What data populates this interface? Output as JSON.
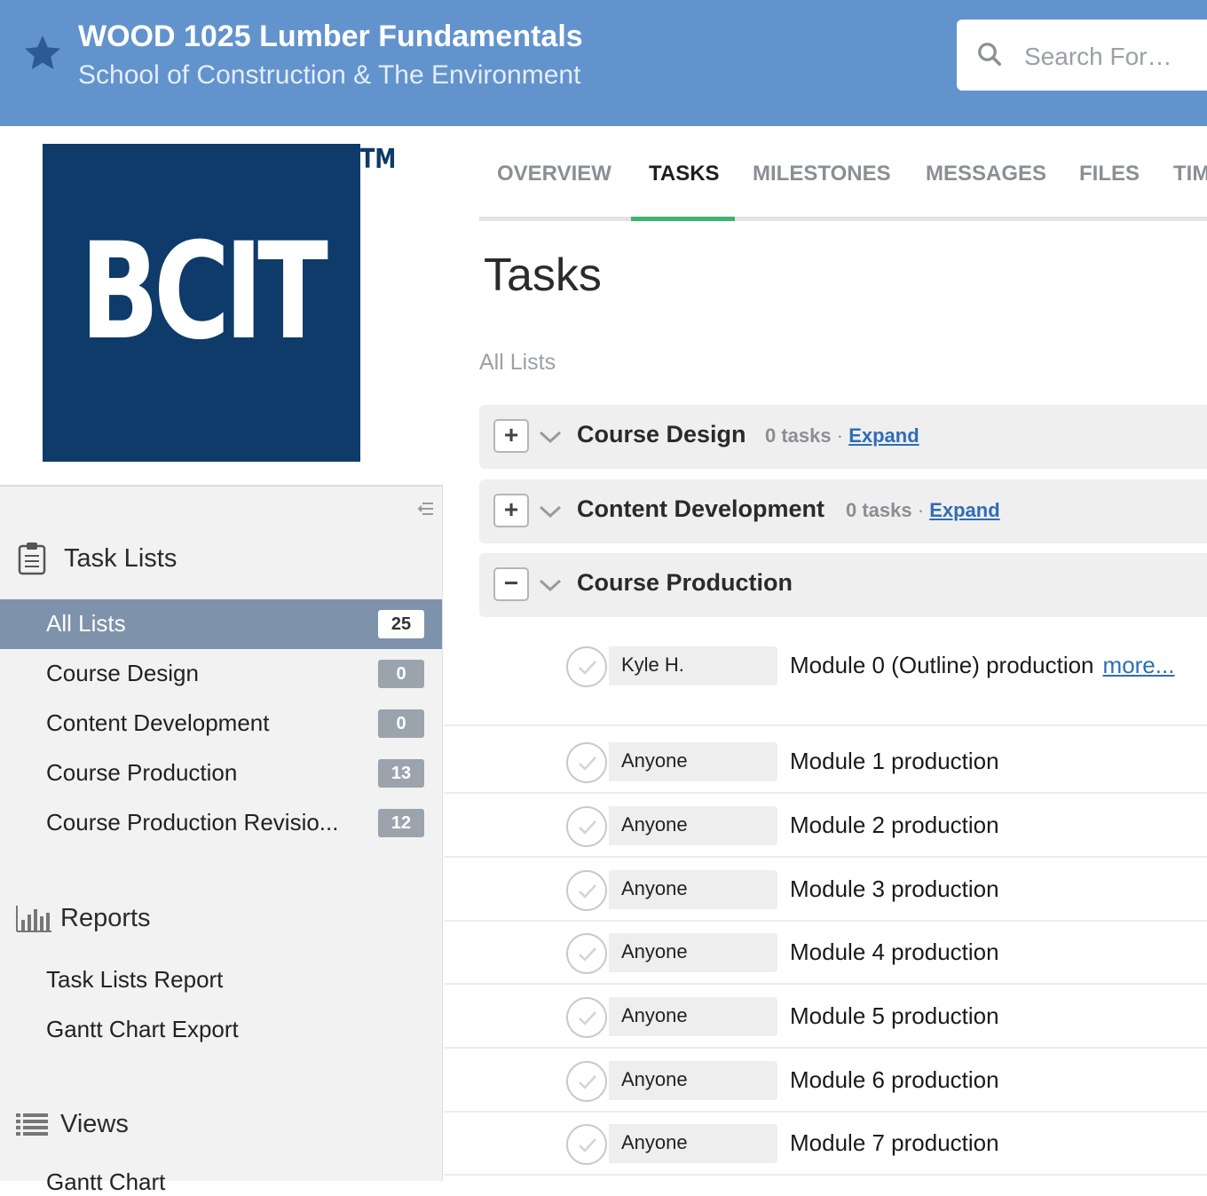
{
  "header": {
    "title": "WOOD 1025 Lumber Fundamentals",
    "subtitle": "School of Construction & The Environment",
    "search_placeholder": "Search For…"
  },
  "sidebar": {
    "logo_text": "BCIT",
    "logo_tm": "TM",
    "task_lists_title": "Task Lists",
    "task_lists": [
      {
        "label": "All Lists",
        "count": "25",
        "active": true
      },
      {
        "label": "Course Design",
        "count": "0"
      },
      {
        "label": "Content Development",
        "count": "0"
      },
      {
        "label": "Course Production",
        "count": "13"
      },
      {
        "label": "Course Production Revisio...",
        "count": "12"
      }
    ],
    "reports_title": "Reports",
    "reports": [
      "Task Lists Report",
      "Gantt Chart Export"
    ],
    "views_title": "Views",
    "views": [
      "Gantt Chart"
    ]
  },
  "tabs": [
    "OVERVIEW",
    "TASKS",
    "MILESTONES",
    "MESSAGES",
    "FILES",
    "TIM"
  ],
  "main": {
    "page_title": "Tasks",
    "all_lists_label": "All Lists",
    "lists": [
      {
        "name": "Course Design",
        "count": "0 tasks",
        "sep": "·",
        "expand": "Expand",
        "toggle": "+"
      },
      {
        "name": "Content Development",
        "count": "0 tasks",
        "sep": "·",
        "expand": "Expand",
        "toggle": "+"
      },
      {
        "name": "Course Production",
        "toggle": "−"
      }
    ],
    "tasks": [
      {
        "assignee": "Kyle H.",
        "name": "Module 0 (Outline) production",
        "more": "more..."
      },
      {
        "assignee": "Anyone",
        "name": "Module 1 production"
      },
      {
        "assignee": "Anyone",
        "name": "Module 2 production"
      },
      {
        "assignee": "Anyone",
        "name": "Module 3 production"
      },
      {
        "assignee": "Anyone",
        "name": "Module 4 production"
      },
      {
        "assignee": "Anyone",
        "name": "Module 5 production"
      },
      {
        "assignee": "Anyone",
        "name": "Module 6 production"
      },
      {
        "assignee": "Anyone",
        "name": "Module 7 production"
      }
    ]
  },
  "colors": {
    "header_bg": "#6293cd",
    "logo_bg": "#0e3b69",
    "active_tab_underline": "#3cb371",
    "active_sidebar_item": "#7e92ab",
    "link": "#2f6db5"
  },
  "icons": [
    "star-icon",
    "search-icon",
    "collapse-icon",
    "clipboard-icon",
    "bar-chart-icon",
    "list-icon",
    "chevron-down-icon",
    "check-icon"
  ]
}
